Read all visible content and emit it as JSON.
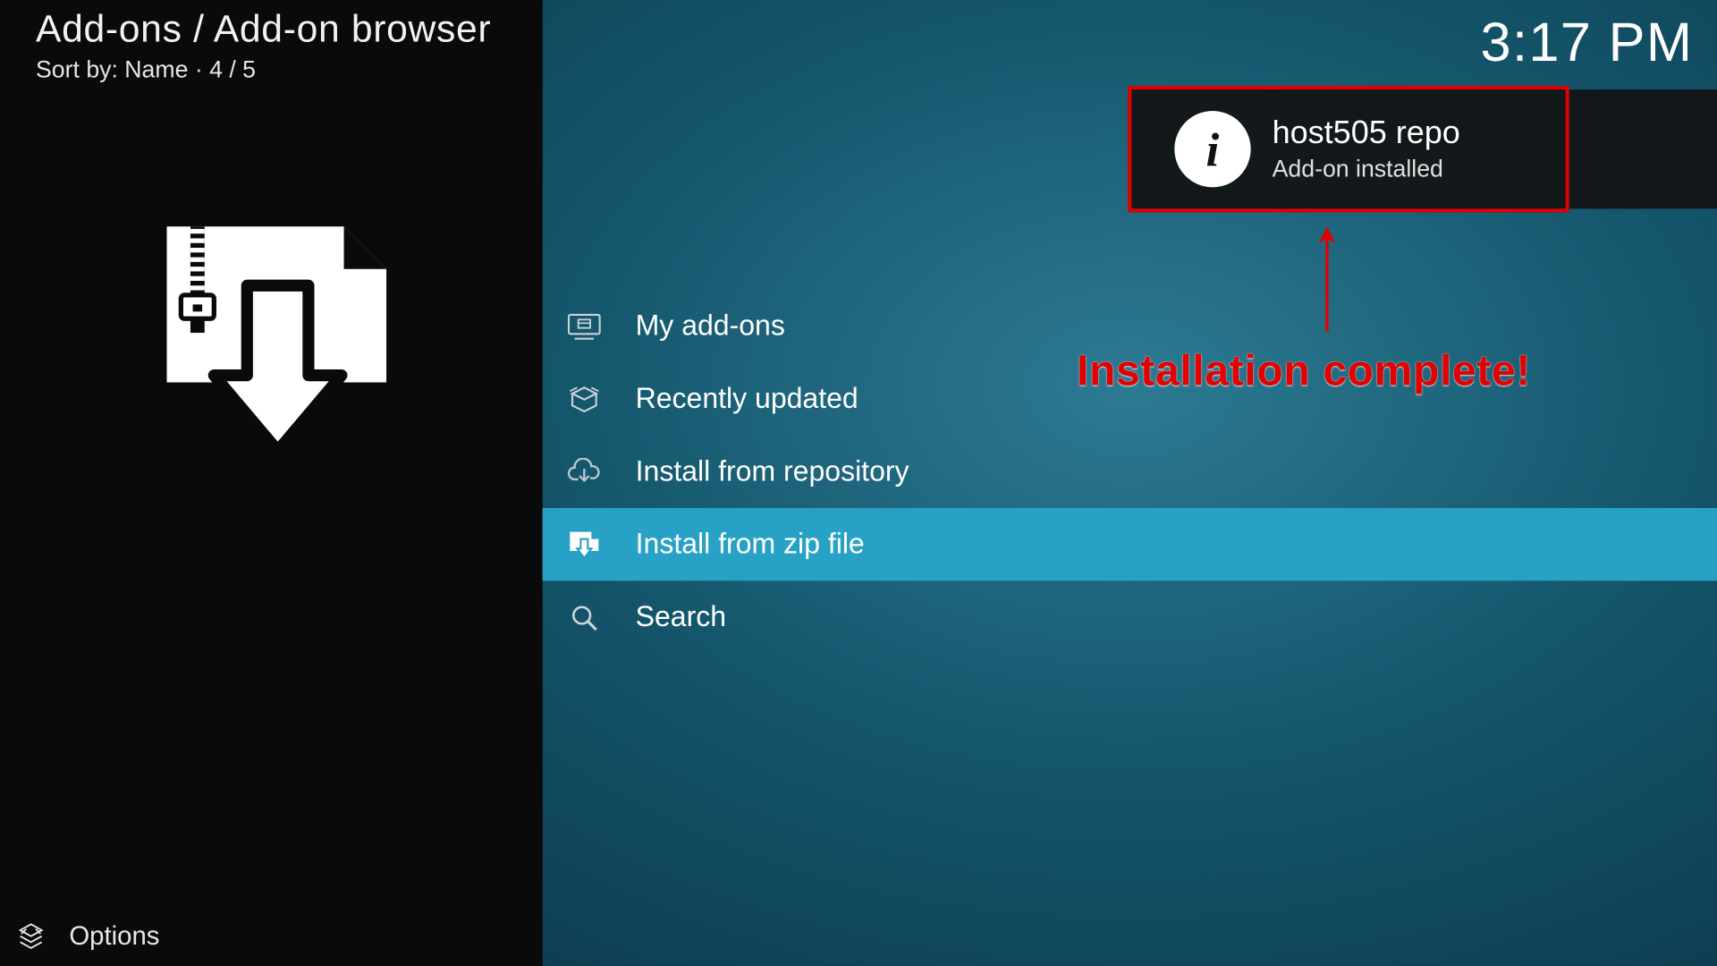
{
  "header": {
    "breadcrumb": "Add-ons / Add-on browser",
    "sort_line": "Sort by: Name  ·  4 / 5",
    "clock": "3:17 PM"
  },
  "sidebar": {
    "options_label": "Options"
  },
  "menu": {
    "items": [
      {
        "id": "my-addons",
        "label": "My add-ons",
        "icon": "monitor-box-icon",
        "selected": false
      },
      {
        "id": "recently-updated",
        "label": "Recently updated",
        "icon": "open-box-icon",
        "selected": false
      },
      {
        "id": "install-repo",
        "label": "Install from repository",
        "icon": "cloud-download-icon",
        "selected": false
      },
      {
        "id": "install-zip",
        "label": "Install from zip file",
        "icon": "zip-file-icon",
        "selected": true
      },
      {
        "id": "search",
        "label": "Search",
        "icon": "search-icon",
        "selected": false
      }
    ]
  },
  "notification": {
    "title": "host505 repo",
    "subtitle": "Add-on installed"
  },
  "annotation": {
    "text": "Installation complete!"
  },
  "colors": {
    "highlight": "#27a1c5",
    "annotation_red": "#e30000"
  }
}
